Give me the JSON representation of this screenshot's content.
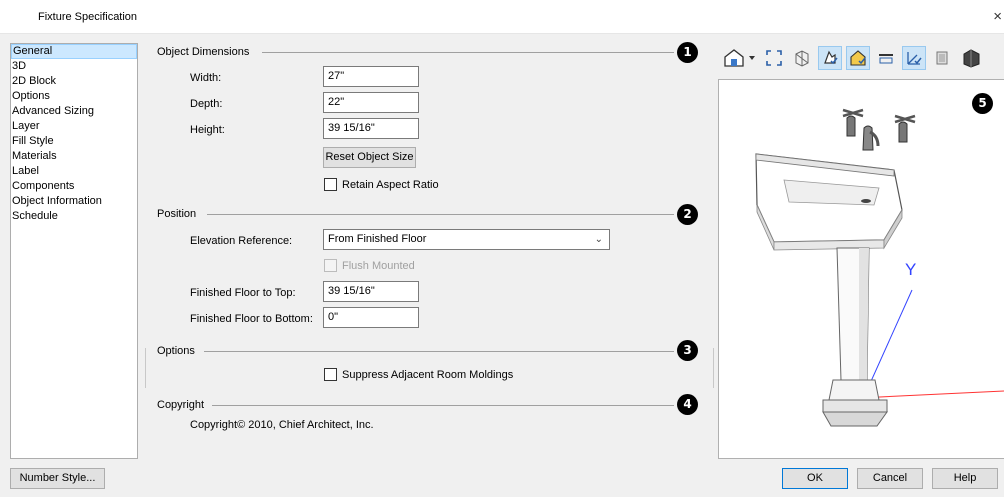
{
  "window": {
    "title": "Fixture Specification",
    "close_glyph": "×"
  },
  "categories": [
    "General",
    "3D",
    "2D Block",
    "Options",
    "Advanced Sizing",
    "Layer",
    "Fill Style",
    "Materials",
    "Label",
    "Components",
    "Object Information",
    "Schedule"
  ],
  "selected_category": "General",
  "object_dimensions": {
    "heading": "Object Dimensions",
    "badge": "1",
    "width_label": "Width:",
    "width_value": "27\"",
    "depth_label": "Depth:",
    "depth_value": "22\"",
    "height_label": "Height:",
    "height_value": "39 15/16\"",
    "reset_button": "Reset Object Size",
    "retain_aspect_label": "Retain Aspect Ratio",
    "retain_aspect_checked": false
  },
  "position": {
    "heading": "Position",
    "badge": "2",
    "elevation_label": "Elevation Reference:",
    "elevation_value": "From Finished Floor",
    "flush_label": "Flush Mounted",
    "flush_checked": false,
    "top_label": "Finished Floor to Top:",
    "top_value": "39 15/16\"",
    "bottom_label": "Finished Floor to Bottom:",
    "bottom_value": "0\""
  },
  "options": {
    "heading": "Options",
    "badge": "3",
    "suppress_label": "Suppress Adjacent Room Moldings",
    "suppress_checked": false
  },
  "copyright": {
    "heading": "Copyright",
    "badge": "4",
    "text": "Copyright© 2010, Chief Architect, Inc."
  },
  "preview": {
    "badge": "5",
    "axis_y_label": "Y",
    "toolbar_icons": [
      "view-type-icon",
      "fit-view-icon",
      "wireframe-icon",
      "camera-icon",
      "show-color-icon",
      "show-patterns-icon",
      "show-axes-icon",
      "show-materials-icon",
      "render-mode-icon"
    ]
  },
  "buttons": {
    "number_style": "Number Style...",
    "ok": "OK",
    "cancel": "Cancel",
    "help": "Help"
  },
  "colors": {
    "badge": "#000000",
    "selection": "#cce8ff",
    "axis_y": "#3344ff",
    "axis_x": "#ff3333"
  }
}
